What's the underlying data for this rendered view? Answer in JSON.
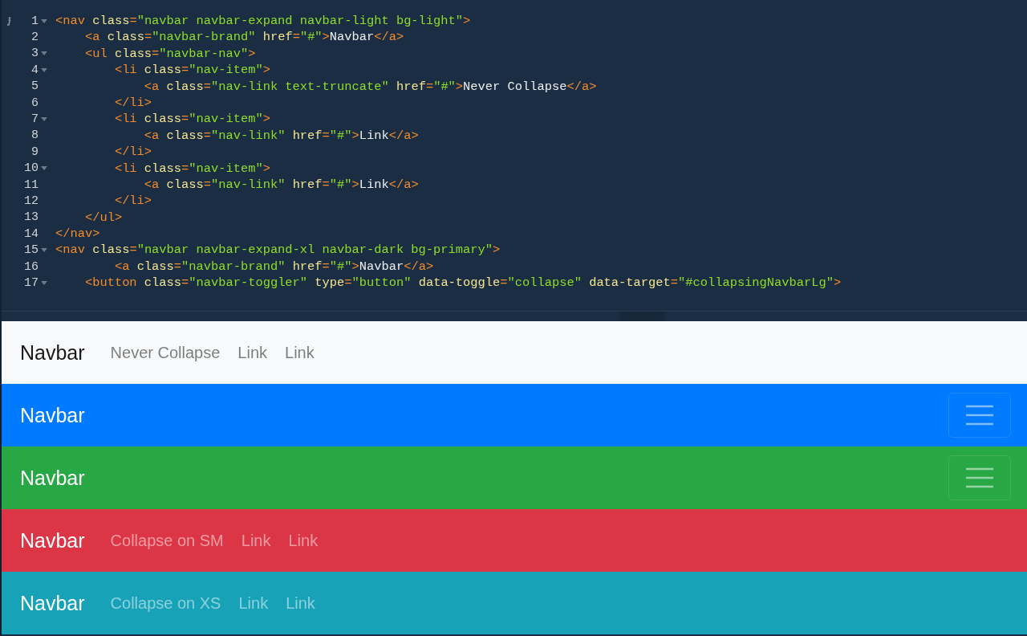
{
  "editor": {
    "lines": [
      {
        "number": "1",
        "foldable": true,
        "info": true,
        "text": "<nav class=\"navbar navbar-expand navbar-light bg-light\">"
      },
      {
        "number": "2",
        "foldable": false,
        "info": false,
        "text": "    <a class=\"navbar-brand\" href=\"#\">Navbar</a>"
      },
      {
        "number": "3",
        "foldable": true,
        "info": false,
        "text": "    <ul class=\"navbar-nav\">"
      },
      {
        "number": "4",
        "foldable": true,
        "info": false,
        "text": "        <li class=\"nav-item\">"
      },
      {
        "number": "5",
        "foldable": false,
        "info": false,
        "text": "            <a class=\"nav-link text-truncate\" href=\"#\">Never Collapse</a>"
      },
      {
        "number": "6",
        "foldable": false,
        "info": false,
        "text": "        </li>"
      },
      {
        "number": "7",
        "foldable": true,
        "info": false,
        "text": "        <li class=\"nav-item\">"
      },
      {
        "number": "8",
        "foldable": false,
        "info": false,
        "text": "            <a class=\"nav-link\" href=\"#\">Link</a>"
      },
      {
        "number": "9",
        "foldable": false,
        "info": false,
        "text": "        </li>"
      },
      {
        "number": "10",
        "foldable": true,
        "info": false,
        "text": "        <li class=\"nav-item\">"
      },
      {
        "number": "11",
        "foldable": false,
        "info": false,
        "text": "            <a class=\"nav-link\" href=\"#\">Link</a>"
      },
      {
        "number": "12",
        "foldable": false,
        "info": false,
        "text": "        </li>"
      },
      {
        "number": "13",
        "foldable": false,
        "info": false,
        "text": "    </ul>"
      },
      {
        "number": "14",
        "foldable": false,
        "info": false,
        "text": "</nav>"
      },
      {
        "number": "15",
        "foldable": true,
        "info": false,
        "text": "<nav class=\"navbar navbar-expand-xl navbar-dark bg-primary\">"
      },
      {
        "number": "16",
        "foldable": false,
        "info": false,
        "text": "        <a class=\"navbar-brand\" href=\"#\">Navbar</a>"
      },
      {
        "number": "17",
        "foldable": true,
        "info": false,
        "text": "    <button class=\"navbar-toggler\" type=\"button\" data-toggle=\"collapse\" data-target=\"#collapsingNavbarLg\">"
      }
    ]
  },
  "navbars": [
    {
      "kind": "light",
      "color": "#f8f9fa",
      "brand": "Navbar",
      "links": [
        "Never Collapse",
        "Link",
        "Link"
      ],
      "toggler": false
    },
    {
      "kind": "dark",
      "color": "#007bff",
      "brand": "Navbar",
      "toggler": true
    },
    {
      "kind": "dark",
      "color": "#28a745",
      "brand": "Navbar",
      "toggler": true
    },
    {
      "kind": "dark",
      "color": "#dc3545",
      "brand": "Navbar",
      "links": [
        "Collapse on SM",
        "Link",
        "Link"
      ],
      "toggler": false
    },
    {
      "kind": "dark",
      "color": "#17a2b8",
      "brand": "Navbar",
      "links": [
        "Collapse on XS",
        "Link",
        "Link"
      ],
      "toggler": false
    }
  ]
}
